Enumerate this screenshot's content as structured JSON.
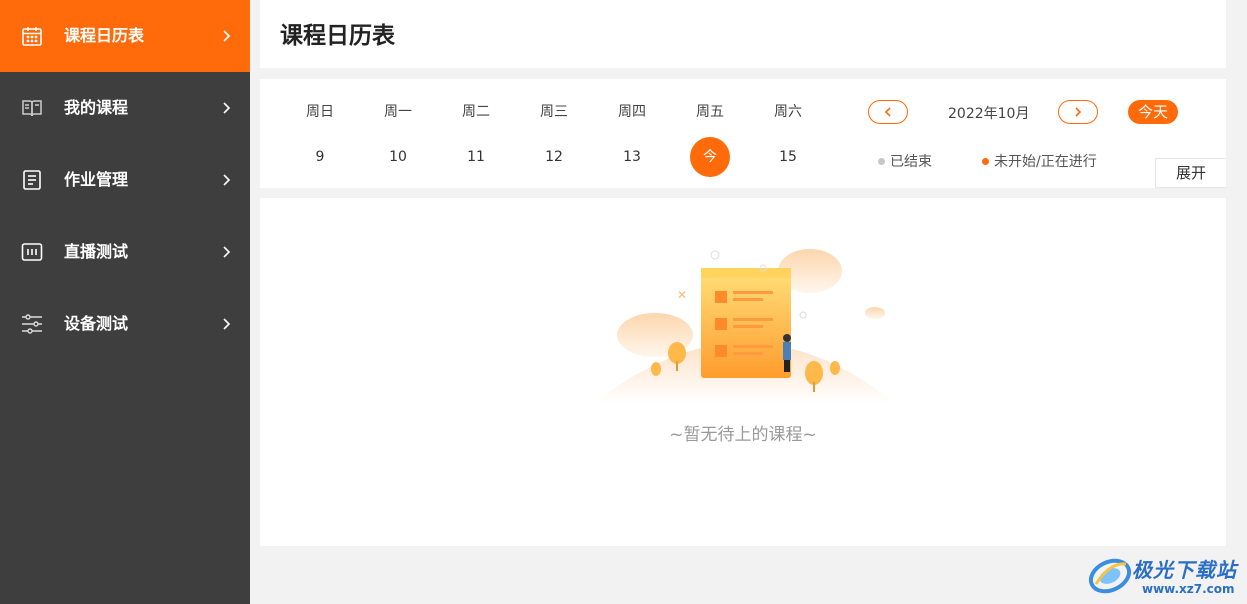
{
  "sidebar": {
    "items": [
      {
        "label": "课程日历表",
        "icon": "calendar-icon",
        "active": true
      },
      {
        "label": "我的课程",
        "icon": "book-icon",
        "active": false
      },
      {
        "label": "作业管理",
        "icon": "document-icon",
        "active": false
      },
      {
        "label": "直播测试",
        "icon": "live-icon",
        "active": false
      },
      {
        "label": "设备测试",
        "icon": "sliders-icon",
        "active": false
      }
    ]
  },
  "header": {
    "title": "课程日历表"
  },
  "calendar": {
    "weekdays": [
      "周日",
      "周一",
      "周二",
      "周三",
      "周四",
      "周五",
      "周六"
    ],
    "days": [
      "9",
      "10",
      "11",
      "12",
      "13",
      "今",
      "15"
    ],
    "month": "2022年10月",
    "today_label": "今天",
    "legend": [
      {
        "label": "已结束",
        "color": "#c8c8c8"
      },
      {
        "label": "未开始/正在进行",
        "color": "#ff6a0a"
      }
    ],
    "expand_label": "展开"
  },
  "empty_state": {
    "text": "~暂无待上的课程~"
  },
  "watermark": {
    "name": "极光下载站",
    "url": "www.xz7.com"
  },
  "colors": {
    "accent": "#ff6a0a",
    "sidebar_bg": "#3e3e3e"
  }
}
